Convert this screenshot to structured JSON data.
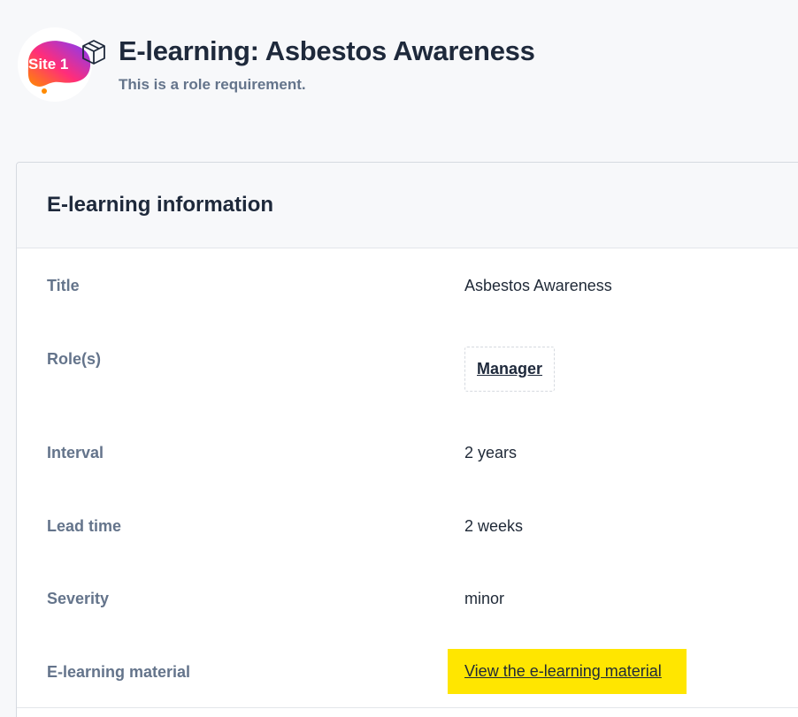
{
  "header": {
    "logo_text": "Site 1",
    "type_icon": "box-icon",
    "title": "E-learning: Asbestos Awareness",
    "subtitle": "This is a role requirement."
  },
  "card": {
    "title": "E-learning information",
    "rows": {
      "title": {
        "label": "Title",
        "value": "Asbestos Awareness"
      },
      "roles": {
        "label": "Role(s)",
        "value": "Manager"
      },
      "interval": {
        "label": "Interval",
        "value": "2 years"
      },
      "lead_time": {
        "label": "Lead time",
        "value": "2 weeks"
      },
      "severity": {
        "label": "Severity",
        "value": "minor"
      },
      "material": {
        "label": "E-learning material",
        "link_text": "View the e-learning material"
      }
    }
  },
  "colors": {
    "highlight": "#ffe600",
    "label_text": "#64748b",
    "heading_text": "#1e293b"
  }
}
